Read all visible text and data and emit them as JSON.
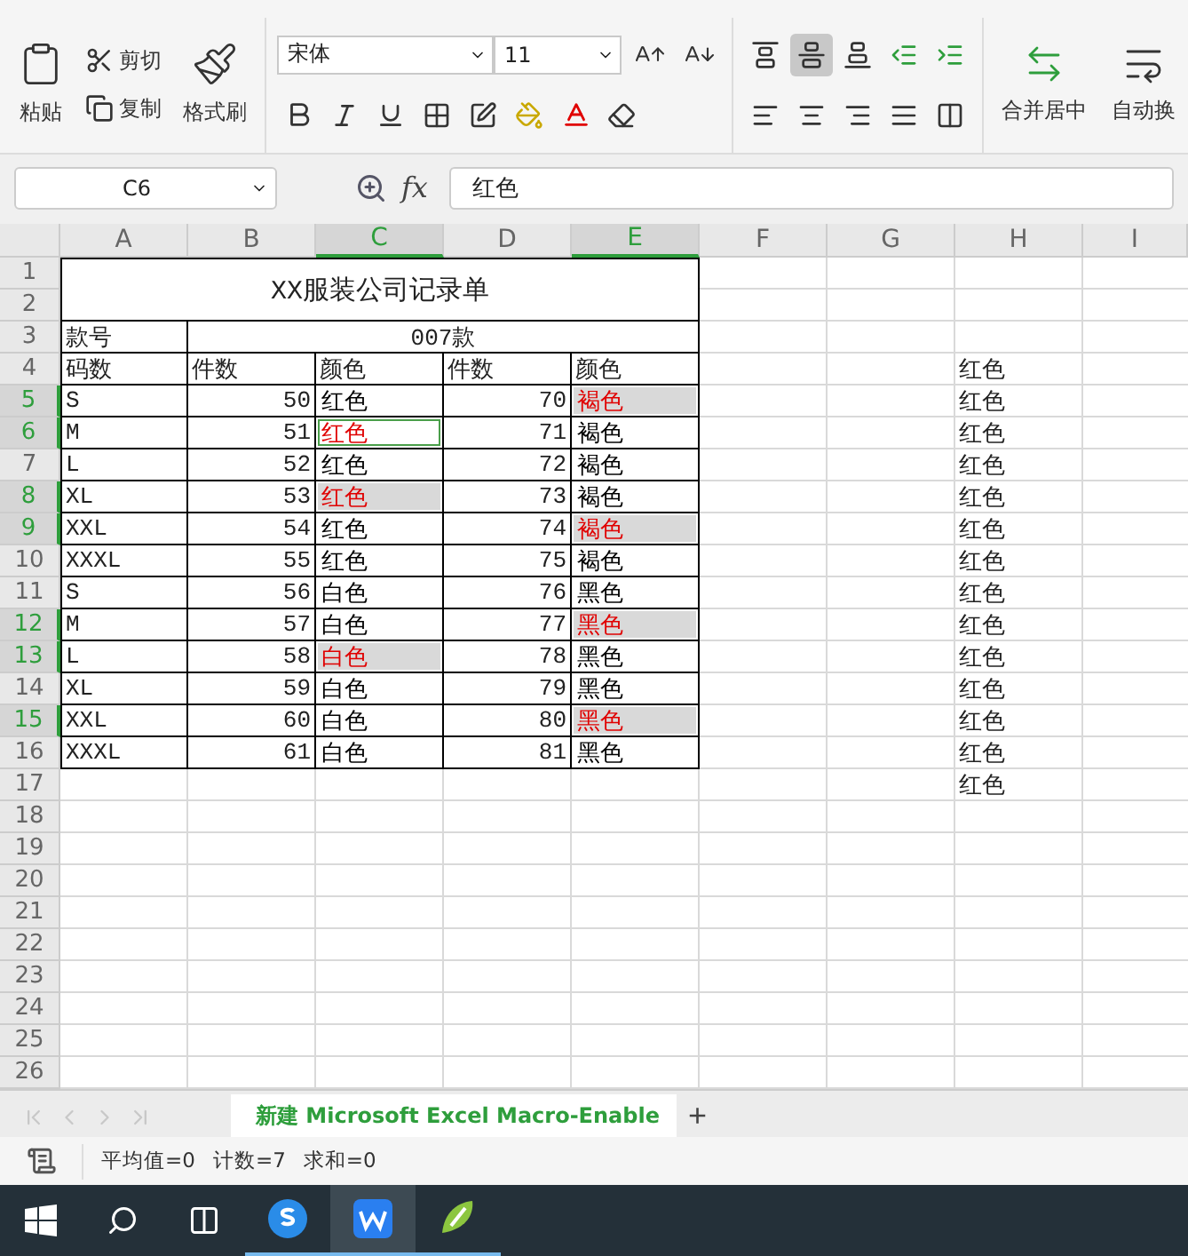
{
  "ribbon": {
    "paste": "粘贴",
    "cut": "剪切",
    "copy": "复制",
    "format_painter": "格式刷",
    "font_name": "宋体",
    "font_size": "11",
    "merge": "合并居中",
    "wrap": "自动换",
    "align_middle_selected": true
  },
  "formula_bar": {
    "name_box": "C6",
    "fx": "fx",
    "value": "红色"
  },
  "columns": [
    "A",
    "B",
    "C",
    "D",
    "E",
    "F",
    "G",
    "H",
    "I"
  ],
  "row_numbers": [
    "1",
    "2",
    "3",
    "4",
    "5",
    "6",
    "7",
    "8",
    "9",
    "10",
    "11",
    "12",
    "13",
    "14",
    "15",
    "16",
    "17",
    "18",
    "19",
    "20",
    "21",
    "22",
    "23",
    "24",
    "25",
    "26"
  ],
  "title": "XX服装公司记录单",
  "style_row": {
    "label": "款号",
    "value": "007款"
  },
  "headers": [
    "码数",
    "件数",
    "颜色",
    "件数",
    "颜色"
  ],
  "rows": [
    {
      "size": "S",
      "qty1": "50",
      "color1": {
        "text": "红色",
        "red": false,
        "selected": false,
        "active": false
      },
      "qty2": "70",
      "color2": {
        "text": "褐色",
        "red": true,
        "selected": true,
        "active": false
      }
    },
    {
      "size": "M",
      "qty1": "51",
      "color1": {
        "text": "红色",
        "red": true,
        "selected": true,
        "active": true
      },
      "qty2": "71",
      "color2": {
        "text": "褐色",
        "red": false,
        "selected": false,
        "active": false
      }
    },
    {
      "size": "L",
      "qty1": "52",
      "color1": {
        "text": "红色",
        "red": false,
        "selected": false,
        "active": false
      },
      "qty2": "72",
      "color2": {
        "text": "褐色",
        "red": false,
        "selected": false,
        "active": false
      }
    },
    {
      "size": "XL",
      "qty1": "53",
      "color1": {
        "text": "红色",
        "red": true,
        "selected": true,
        "active": false
      },
      "qty2": "73",
      "color2": {
        "text": "褐色",
        "red": false,
        "selected": false,
        "active": false
      }
    },
    {
      "size": "XXL",
      "qty1": "54",
      "color1": {
        "text": "红色",
        "red": false,
        "selected": false,
        "active": false
      },
      "qty2": "74",
      "color2": {
        "text": "褐色",
        "red": true,
        "selected": true,
        "active": false
      }
    },
    {
      "size": "XXXL",
      "qty1": "55",
      "color1": {
        "text": "红色",
        "red": false,
        "selected": false,
        "active": false
      },
      "qty2": "75",
      "color2": {
        "text": "褐色",
        "red": false,
        "selected": false,
        "active": false
      }
    },
    {
      "size": "S",
      "qty1": "56",
      "color1": {
        "text": "白色",
        "red": false,
        "selected": false,
        "active": false
      },
      "qty2": "76",
      "color2": {
        "text": "黑色",
        "red": false,
        "selected": false,
        "active": false
      }
    },
    {
      "size": "M",
      "qty1": "57",
      "color1": {
        "text": "白色",
        "red": false,
        "selected": false,
        "active": false
      },
      "qty2": "77",
      "color2": {
        "text": "黑色",
        "red": true,
        "selected": true,
        "active": false
      }
    },
    {
      "size": "L",
      "qty1": "58",
      "color1": {
        "text": "白色",
        "red": true,
        "selected": true,
        "active": false
      },
      "qty2": "78",
      "color2": {
        "text": "黑色",
        "red": false,
        "selected": false,
        "active": false
      }
    },
    {
      "size": "XL",
      "qty1": "59",
      "color1": {
        "text": "白色",
        "red": false,
        "selected": false,
        "active": false
      },
      "qty2": "79",
      "color2": {
        "text": "黑色",
        "red": false,
        "selected": false,
        "active": false
      }
    },
    {
      "size": "XXL",
      "qty1": "60",
      "color1": {
        "text": "白色",
        "red": false,
        "selected": false,
        "active": false
      },
      "qty2": "80",
      "color2": {
        "text": "黑色",
        "red": true,
        "selected": true,
        "active": false
      }
    },
    {
      "size": "XXXL",
      "qty1": "61",
      "color1": {
        "text": "白色",
        "red": false,
        "selected": false,
        "active": false
      },
      "qty2": "81",
      "color2": {
        "text": "黑色",
        "red": false,
        "selected": false,
        "active": false
      }
    }
  ],
  "column_h": [
    "红色",
    "红色",
    "红色",
    "红色",
    "红色",
    "红色",
    "红色",
    "红色",
    "红色",
    "红色",
    "红色",
    "红色",
    "红色",
    "红色"
  ],
  "sheet_tab": {
    "label": "新建 Microsoft Excel Macro-Enable",
    "selected": true
  },
  "add_sheet": "+",
  "status": [
    "平均值=0",
    "计数=7",
    "求和=0"
  ],
  "taskbar": [
    {
      "kind": "sogou",
      "selected": false
    },
    {
      "kind": "wps",
      "selected": true
    },
    {
      "kind": "draw",
      "selected": false
    }
  ]
}
